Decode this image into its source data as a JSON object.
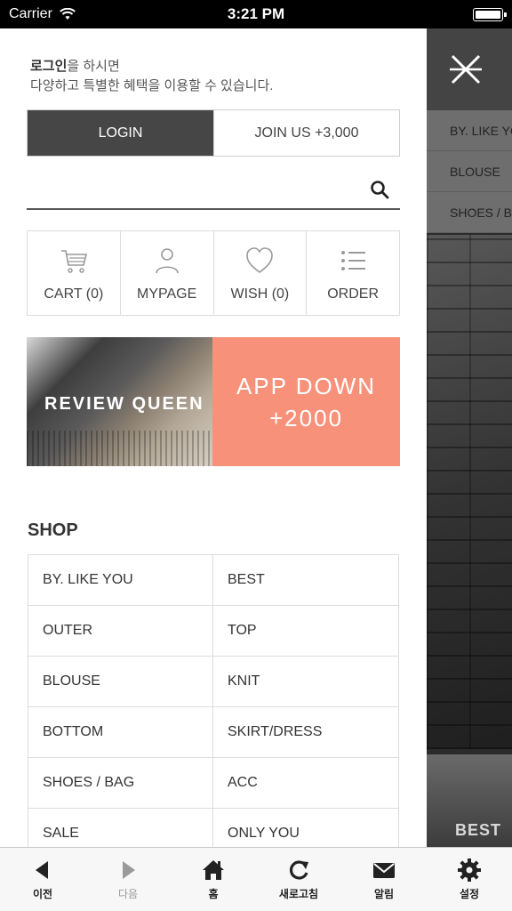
{
  "status_bar": {
    "carrier": "Carrier",
    "time": "3:21 PM"
  },
  "backdrop": {
    "menu_items": [
      "BY. LIKE YOU",
      "BLOUSE",
      "SHOES / BAG"
    ],
    "best_label": "BEST"
  },
  "drawer": {
    "greeting_strong": "로그인",
    "greeting_rest": "을 하시면",
    "greeting_line2": "다양하고 특별한 혜택을 이용할 수 있습니다.",
    "login_label": "LOGIN",
    "join_label": "JOIN US +3,000",
    "quick_links": [
      {
        "label": "CART (0)",
        "icon": "cart-icon"
      },
      {
        "label": "MYPAGE",
        "icon": "user-icon"
      },
      {
        "label": "WISH (0)",
        "icon": "heart-icon"
      },
      {
        "label": "ORDER",
        "icon": "list-icon"
      }
    ],
    "banner": {
      "left_text": "REVIEW QUEEN",
      "right_line1": "APP DOWN",
      "right_line2": "+2000",
      "accent_color": "#f7917a"
    },
    "shop_title": "SHOP",
    "shop_items": [
      "BY. LIKE YOU",
      "BEST",
      "OUTER",
      "TOP",
      "BLOUSE",
      "KNIT",
      "BOTTOM",
      "SKIRT/DRESS",
      "SHOES / BAG",
      "ACC",
      "SALE",
      "ONLY YOU"
    ]
  },
  "toolbar": [
    {
      "label": "이전",
      "icon": "back-arrow-icon",
      "enabled": true
    },
    {
      "label": "다음",
      "icon": "forward-arrow-icon",
      "enabled": false
    },
    {
      "label": "홈",
      "icon": "home-icon",
      "enabled": true
    },
    {
      "label": "새로고침",
      "icon": "refresh-icon",
      "enabled": true
    },
    {
      "label": "알림",
      "icon": "mail-icon",
      "enabled": true
    },
    {
      "label": "설정",
      "icon": "gear-icon",
      "enabled": true
    }
  ]
}
